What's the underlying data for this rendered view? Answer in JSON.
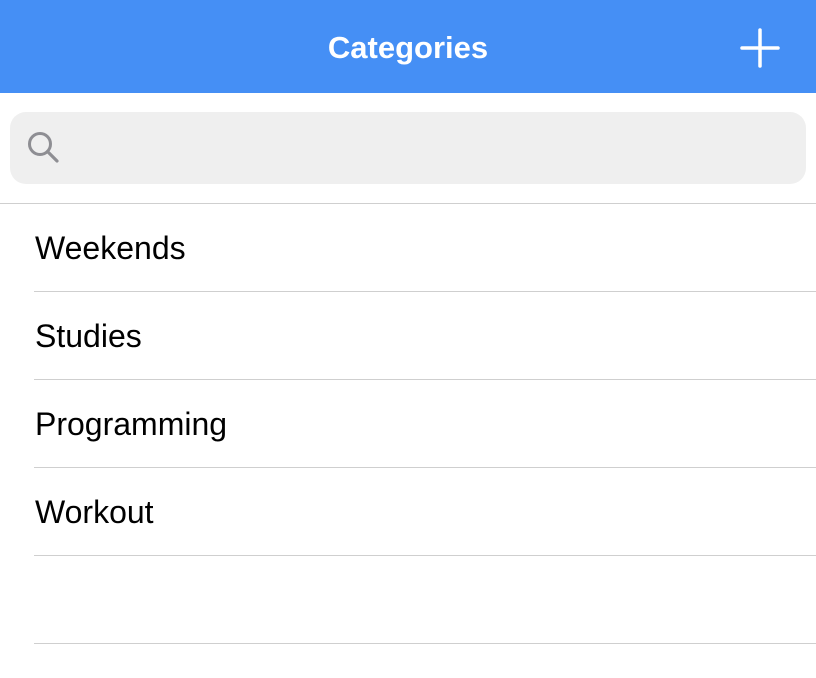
{
  "navbar": {
    "title": "Categories",
    "add_icon": "plus-icon",
    "color": "#458ff5"
  },
  "search": {
    "icon": "search-icon",
    "value": "",
    "placeholder": ""
  },
  "categories": [
    {
      "label": "Weekends"
    },
    {
      "label": "Studies"
    },
    {
      "label": "Programming"
    },
    {
      "label": "Workout"
    },
    {
      "label": ""
    }
  ]
}
